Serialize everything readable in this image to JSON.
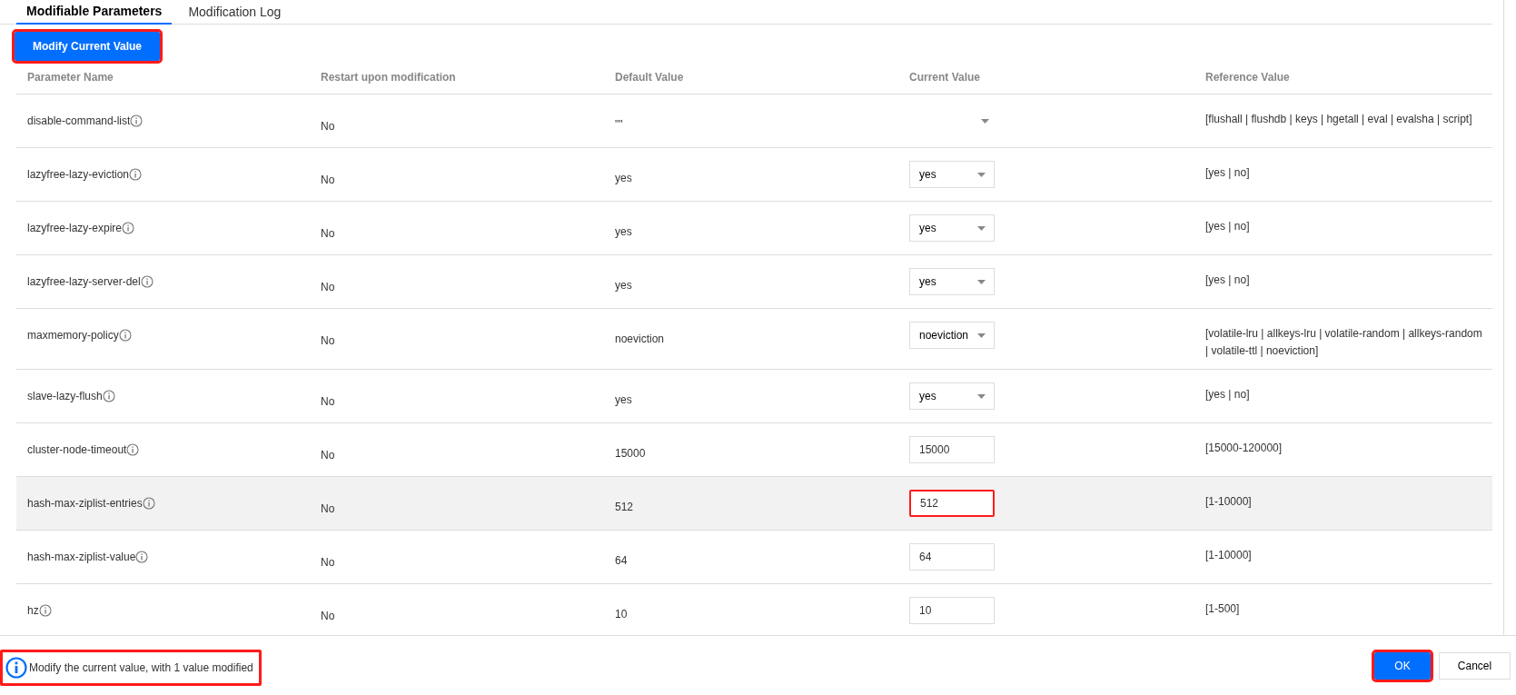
{
  "tabs": [
    {
      "label": "Modifiable Parameters",
      "selected": true
    },
    {
      "label": "Modification Log",
      "selected": false
    }
  ],
  "action_button": {
    "label": "Modify Current Value",
    "annotated": true
  },
  "table": {
    "columns": [
      "Parameter Name",
      "Restart upon modification",
      "Default Value",
      "Current Value",
      "Reference Value"
    ],
    "rows": [
      {
        "name": "disable-command-list",
        "restart": "No",
        "default": "\"\"",
        "current": {
          "kind": "empty-select"
        },
        "reference": "[flushall | flushdb | keys | hgetall | eval | evalsha | script]",
        "hovered": false
      },
      {
        "name": "lazyfree-lazy-eviction",
        "restart": "No",
        "default": "yes",
        "current": {
          "kind": "select",
          "value": "yes",
          "annotated": false
        },
        "reference": "[yes | no]",
        "hovered": false
      },
      {
        "name": "lazyfree-lazy-expire",
        "restart": "No",
        "default": "yes",
        "current": {
          "kind": "select",
          "value": "yes",
          "annotated": false
        },
        "reference": "[yes | no]",
        "hovered": false
      },
      {
        "name": "lazyfree-lazy-server-del",
        "restart": "No",
        "default": "yes",
        "current": {
          "kind": "select",
          "value": "yes",
          "annotated": false
        },
        "reference": "[yes | no]",
        "hovered": false
      },
      {
        "name": "maxmemory-policy",
        "restart": "No",
        "default": "noeviction",
        "current": {
          "kind": "select",
          "value": "noeviction",
          "annotated": false
        },
        "reference": "[volatile-lru | allkeys-lru | volatile-random | allkeys-random | volatile-ttl | noeviction]",
        "hovered": false
      },
      {
        "name": "slave-lazy-flush",
        "restart": "No",
        "default": "yes",
        "current": {
          "kind": "select",
          "value": "yes",
          "annotated": false
        },
        "reference": "[yes | no]",
        "hovered": false
      },
      {
        "name": "cluster-node-timeout",
        "restart": "No",
        "default": "15000",
        "current": {
          "kind": "input",
          "value": "15000",
          "annotated": false
        },
        "reference": "[15000-120000]",
        "hovered": false
      },
      {
        "name": "hash-max-ziplist-entries",
        "restart": "No",
        "default": "512",
        "current": {
          "kind": "input",
          "value": "512",
          "annotated": true
        },
        "reference": "[1-10000]",
        "hovered": true
      },
      {
        "name": "hash-max-ziplist-value",
        "restart": "No",
        "default": "64",
        "current": {
          "kind": "input",
          "value": "64",
          "annotated": false
        },
        "reference": "[1-10000]",
        "hovered": false
      },
      {
        "name": "hz",
        "restart": "No",
        "default": "10",
        "current": {
          "kind": "input",
          "value": "10",
          "annotated": false
        },
        "reference": "[1-500]",
        "hovered": false
      }
    ]
  },
  "footer": {
    "notice": "Modify the current value, with 1 value modified",
    "notice_annotated": true,
    "buttons": [
      {
        "label": "OK",
        "kind": "primary",
        "annotated": true
      },
      {
        "label": "Cancel",
        "kind": "secondary",
        "annotated": false
      }
    ]
  }
}
